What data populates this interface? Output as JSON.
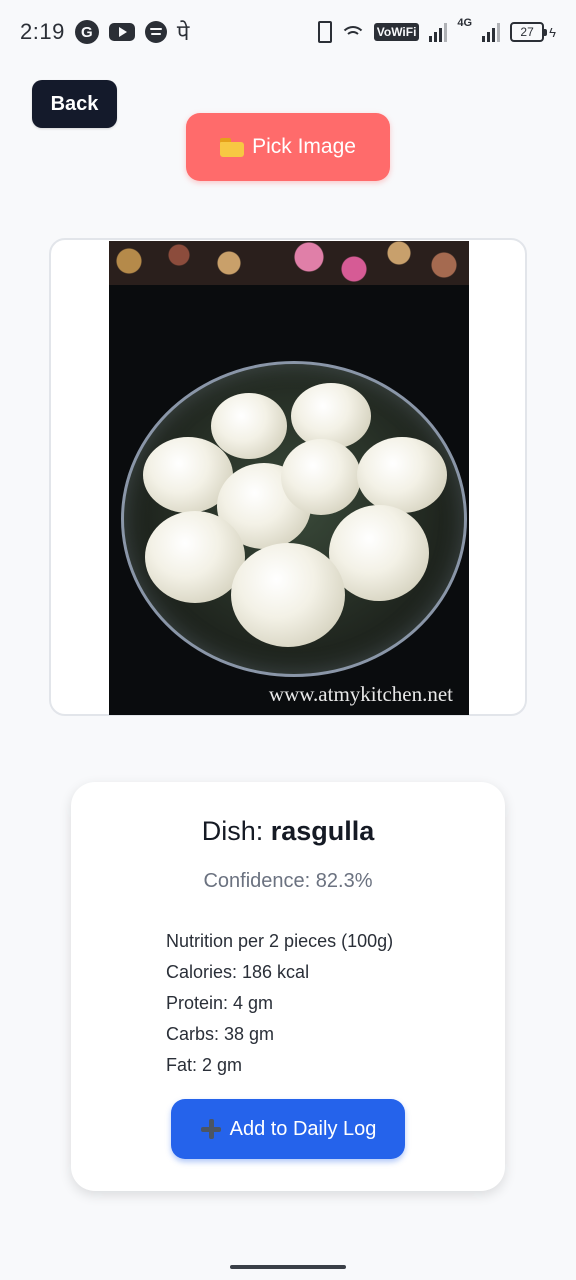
{
  "status_bar": {
    "time": "2:19",
    "app_icons": [
      "google-icon",
      "youtube-icon",
      "spotify-icon",
      "phonepe-icon"
    ],
    "phonepe_glyph": "पे",
    "google_glyph": "G",
    "vowifi": "VoWiFi",
    "network_type": "4G",
    "battery": "27"
  },
  "header": {
    "back_label": "Back",
    "pick_image_label": "Pick Image"
  },
  "photo": {
    "watermark": "www.atmykitchen.net"
  },
  "result": {
    "dish_prefix": "Dish: ",
    "dish_name": "rasgulla",
    "confidence": "Confidence: 82.3%",
    "nutrition": [
      "Nutrition per 2 pieces (100g)",
      "Calories: 186 kcal",
      "Protein: 4 gm",
      "Carbs: 38 gm",
      "Fat: 2 gm"
    ],
    "add_label": "Add to Daily Log"
  },
  "colors": {
    "back_button": "#141a2b",
    "pick_button": "#ff6b6b",
    "add_button": "#2563eb",
    "background": "#f8f9fb"
  }
}
